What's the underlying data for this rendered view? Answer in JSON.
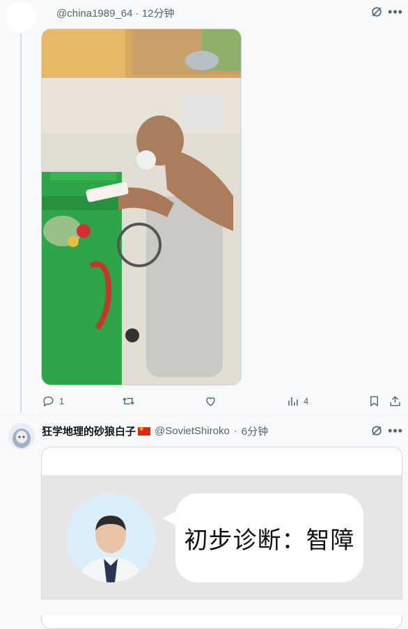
{
  "tweet1": {
    "handle": "@china1989_64",
    "time": "12分钟",
    "separator": "·",
    "actions": {
      "replies": "1",
      "reposts": "",
      "likes": "",
      "views": "4"
    },
    "icons": [
      "grok-icon",
      "more-icon",
      "reply-icon",
      "repost-icon",
      "like-icon",
      "views-icon",
      "bookmark-icon",
      "share-icon"
    ]
  },
  "tweet2": {
    "display_name": "狂学地理的砂狼白子",
    "handle": "@SovietShiroko",
    "separator": "·",
    "time": "6分钟",
    "meme_text": "初步诊断：智障"
  },
  "colors": {
    "background": "#f7f9fa",
    "secondary_text": "#536471",
    "border": "#cfd9de",
    "bin_green": "#2ea043"
  }
}
